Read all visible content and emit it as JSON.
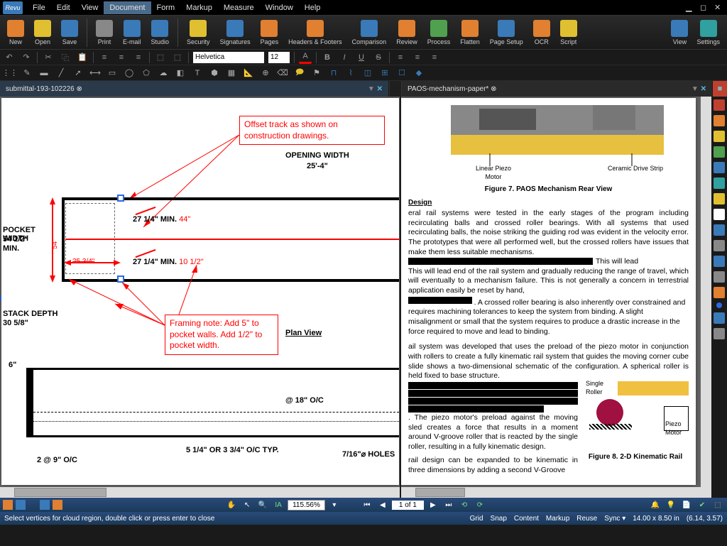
{
  "app": {
    "name": "Revu"
  },
  "menu": {
    "items": [
      "File",
      "Edit",
      "View",
      "Document",
      "Form",
      "Markup",
      "Measure",
      "Window",
      "Help"
    ],
    "active": "Document"
  },
  "ribbon": {
    "items": [
      {
        "label": "New",
        "color": "ic-orange"
      },
      {
        "label": "Open",
        "color": "ic-yellow"
      },
      {
        "label": "Save",
        "color": "ic-blue"
      },
      {
        "label": "Print",
        "color": "ic-gray"
      },
      {
        "label": "E-mail",
        "color": "ic-blue"
      },
      {
        "label": "Studio",
        "color": "ic-blue"
      }
    ],
    "items2": [
      {
        "label": "Security",
        "color": "ic-yellow"
      },
      {
        "label": "Signatures",
        "color": "ic-blue"
      },
      {
        "label": "Pages",
        "color": "ic-orange"
      },
      {
        "label": "Headers & Footers",
        "color": "ic-orange"
      },
      {
        "label": "Comparison",
        "color": "ic-blue"
      },
      {
        "label": "Review",
        "color": "ic-orange"
      },
      {
        "label": "Process",
        "color": "ic-green"
      },
      {
        "label": "Flatten",
        "color": "ic-orange"
      },
      {
        "label": "Page Setup",
        "color": "ic-blue"
      },
      {
        "label": "OCR",
        "color": "ic-orange"
      },
      {
        "label": "Script",
        "color": "ic-yellow"
      }
    ],
    "right": [
      {
        "label": "View",
        "color": "ic-blue"
      },
      {
        "label": "Settings",
        "color": "ic-teal"
      }
    ]
  },
  "quicktoolbar": {
    "font": "Helvetica",
    "fontsize": "12"
  },
  "tabs": {
    "left": {
      "title": "submittal-193-102226",
      "pinned": true
    },
    "right": {
      "title": "PAOS-mechanism-paper*",
      "dirty": true
    }
  },
  "leftdoc": {
    "callout1": "Offset track as shown on construction drawings.",
    "callout2": "Framing note: Add 5\" to pocket walls. Add 1/2\" to pocket width.",
    "opening_width_label": "OPENING WIDTH",
    "opening_width_val": "25'-4\"",
    "pocket_width_label": "POCKET WIDTH",
    "pocket_width_val1": "54 1/2\"",
    "pocket_width_min": "MIN.",
    "stack_depth_label": "STACK DEPTH",
    "stack_depth_val": "30 5/8\"",
    "dim27a": "27 1/4\" MIN.",
    "dim27a_red": "44\"",
    "dim27b": "27 1/4\" MIN.",
    "dim27b_red": "10 1/2\"",
    "dim25red": "25 3/4\"",
    "dim54red": "54\"",
    "plan_view": "Plan View",
    "six_inch": "6\"",
    "oc18": "@ 18\" O/C",
    "oc_typ": "5 1/4\" OR 3 3/4\" O/C TYP.",
    "two_at_nine": "2 @ 9\" O/C",
    "holes716": "7/16\"⌀ HOLES"
  },
  "rightdoc": {
    "linear_piezo": "Linear  Piezo Motor",
    "ceramic_drive": "Ceramic Drive Strip",
    "fig7": "Figure 7.  PAOS Mechanism Rear View",
    "design_hdr": "Design",
    "para1": "eral rail systems were tested in the early stages of the program including recirculating balls and crossed roller bearings.  With all systems that used recirculating balls, the noise striking the guiding rod was evident in the velocity error.  The prototypes that were all performed well, but the crossed rollers have issues that make them less suitable mechanisms.",
    "para1b": "This will lead end of the rail system and gradually reducing the range of travel, which will eventually to a mechanism failure.  This is not generally a concern in terrestrial application easily be reset by hand,",
    "para1c": ".  A crossed roller bearing is also inherently over constrained and requires machining tolerances to keep the system from binding.  A slight misalignment or small that the system requires to produce a drastic increase in the force required to move and lead to binding.",
    "para2": "ail system was developed that uses the preload of the piezo motor in conjunction with rollers to create a fully kinematic rail system that guides the moving corner cube slide shows a two-dimensional schematic of the configuration.  A spherical roller is held fixed to base structure.",
    "para2b": ".  The piezo motor's preload against the moving sled creates a force that results in a moment around V-groove roller that is reacted by the single roller, resulting in a fully kinematic design.",
    "para3": "rail design can be expanded to be kinematic in three dimensions by adding a second V-Groove",
    "single_roller": "Single Roller",
    "piezo_motor": "Piezo Motor",
    "fig8": "Figure 8.  2-D Kinematic Rail"
  },
  "nav": {
    "zoom": "115.56%",
    "page": "1 of 1"
  },
  "status": {
    "hint": "Select vertices for cloud region, double click or press enter to close",
    "grid": "Grid",
    "snap": "Snap",
    "content": "Content",
    "markup": "Markup",
    "reuse": "Reuse",
    "sync": "Sync",
    "pagesize": "14.00 x 8.50 in",
    "coords": "(6.14, 3.57)"
  }
}
